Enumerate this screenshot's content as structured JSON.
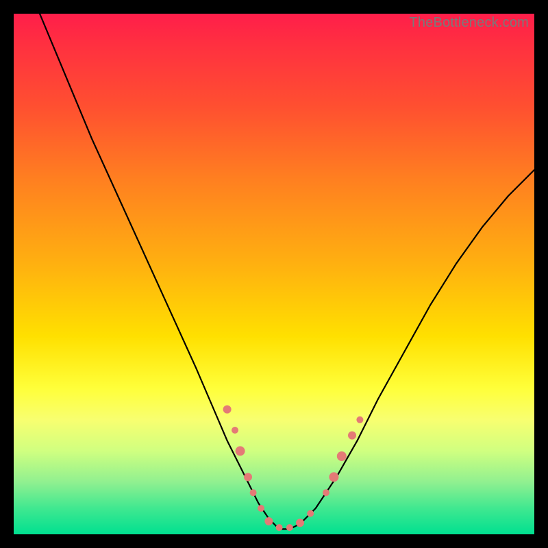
{
  "watermark": "TheBottleneck.com",
  "colors": {
    "curve": "#000000",
    "dots": "#e47a76",
    "gradient_top": "#ff1e4a",
    "gradient_bottom": "#00e090"
  },
  "chart_data": {
    "type": "line",
    "title": "",
    "xlabel": "",
    "ylabel": "",
    "xlim": [
      0,
      100
    ],
    "ylim": [
      0,
      100
    ],
    "series": [
      {
        "name": "bottleneck-curve",
        "x": [
          5,
          10,
          15,
          20,
          25,
          30,
          35,
          38,
          41,
          44,
          47,
          49,
          51,
          53,
          55,
          58,
          62,
          66,
          70,
          75,
          80,
          85,
          90,
          95,
          100
        ],
        "y": [
          100,
          88,
          76,
          65,
          54,
          43,
          32,
          25,
          18,
          12,
          6,
          3,
          1,
          1,
          2,
          5,
          11,
          18,
          26,
          35,
          44,
          52,
          59,
          65,
          70
        ]
      }
    ],
    "markers": [
      {
        "x": 41,
        "y": 24,
        "r": 6
      },
      {
        "x": 42.5,
        "y": 20,
        "r": 5
      },
      {
        "x": 43.5,
        "y": 16,
        "r": 7
      },
      {
        "x": 45,
        "y": 11,
        "r": 6
      },
      {
        "x": 46,
        "y": 8,
        "r": 5
      },
      {
        "x": 47.5,
        "y": 5,
        "r": 5
      },
      {
        "x": 49,
        "y": 2.5,
        "r": 6
      },
      {
        "x": 51,
        "y": 1.3,
        "r": 5
      },
      {
        "x": 53,
        "y": 1.3,
        "r": 5
      },
      {
        "x": 55,
        "y": 2.2,
        "r": 6
      },
      {
        "x": 57,
        "y": 4,
        "r": 5
      },
      {
        "x": 60,
        "y": 8,
        "r": 5
      },
      {
        "x": 61.5,
        "y": 11,
        "r": 7
      },
      {
        "x": 63,
        "y": 15,
        "r": 7
      },
      {
        "x": 65,
        "y": 19,
        "r": 6
      },
      {
        "x": 66.5,
        "y": 22,
        "r": 5
      }
    ]
  }
}
